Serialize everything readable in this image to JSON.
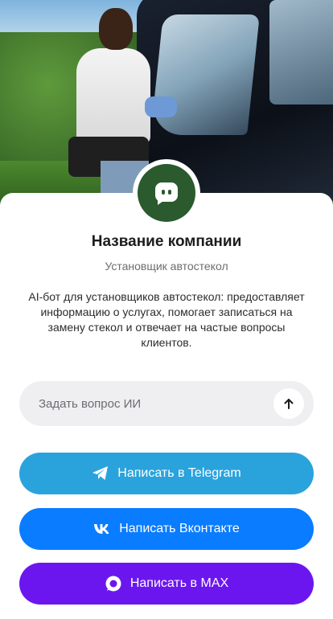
{
  "company": {
    "name": "Название компании",
    "subtitle": "Установщик автостекол",
    "description": "AI-бот для установщиков автостекол: предоставляет информацию о услугах, помогает записаться на замену стекол и отвечает на частые вопросы клиентов."
  },
  "ask": {
    "placeholder": "Задать вопрос ИИ",
    "value": "",
    "send_icon": "arrow-up-icon"
  },
  "actions": [
    {
      "label": "Написать в Telegram",
      "icon": "telegram-icon",
      "color": "#2aa3dd"
    },
    {
      "label": "Написать Вконтакте",
      "icon": "vk-icon",
      "color": "#0a7cff"
    },
    {
      "label": "Написать в MAX",
      "icon": "max-icon",
      "color": "#6c16ef"
    }
  ],
  "avatar": {
    "icon": "bot-chat-icon",
    "color": "#2a5a2d"
  },
  "hero": {
    "icon": "photo-auto-glass-installer"
  }
}
